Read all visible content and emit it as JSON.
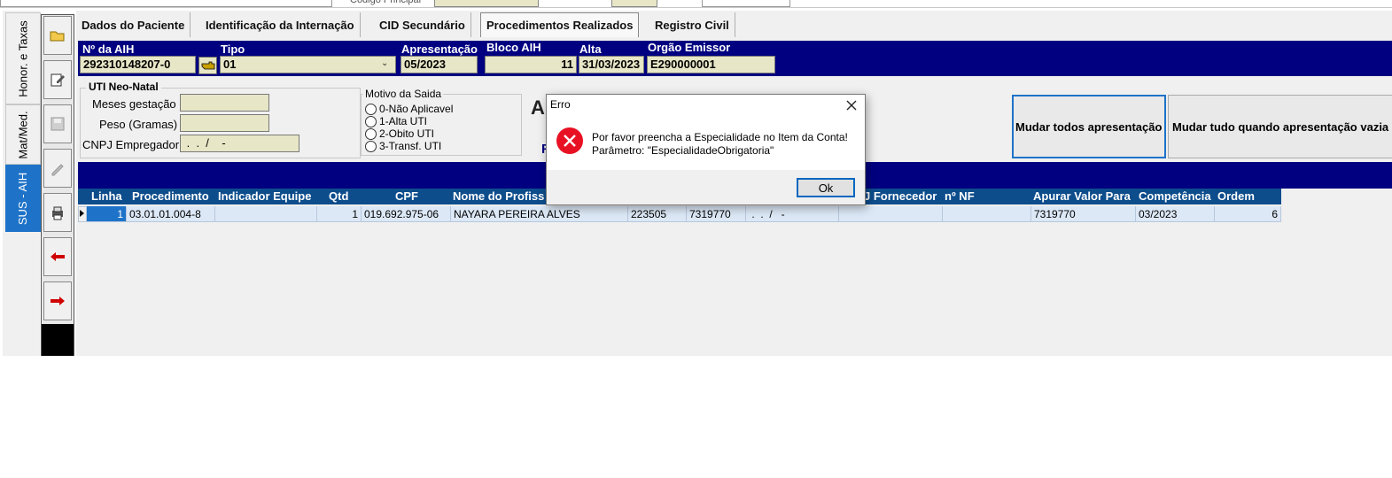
{
  "top_fragment": {
    "label": "Código Principal"
  },
  "side_tabs": [
    {
      "label": "Honor. e Taxas"
    },
    {
      "label": "Mat/Med."
    },
    {
      "label": "SUS - AIH"
    }
  ],
  "toolbar_icons": [
    "folder-open-icon",
    "edit-icon",
    "save-icon",
    "pen-icon",
    "printer-icon",
    "arrow-left-icon",
    "arrow-right-icon"
  ],
  "tabs": [
    {
      "label": "Dados do Paciente"
    },
    {
      "label": "Identificação da Internação"
    },
    {
      "label": "CID Secundário"
    },
    {
      "label": "Procedimentos Realizados"
    },
    {
      "label": "Registro Civil"
    }
  ],
  "header": {
    "aih_label": "Nº da AIH",
    "aih_value": "292310148207-0",
    "tipo_label": "Tipo",
    "tipo_value": "01",
    "apresentacao_label": "Apresentação",
    "apresentacao_value": "05/2023",
    "bloco_label": "Bloco AIH",
    "bloco_value": "11",
    "alta_label": "Alta",
    "alta_value": "31/03/2023",
    "orgao_label": "Orgão Emissor",
    "orgao_value": "E290000001"
  },
  "uti": {
    "title": "UTI Neo-Natal",
    "meses_label": "Meses gestação",
    "peso_label": "Peso (Gramas)",
    "cnpj_label": "CNPJ Empregador",
    "cnpj_value": " .  .  /    -"
  },
  "motivo": {
    "title": "Motivo da Saida",
    "options": [
      "0-Não Aplicavel",
      "1-Alta UTI",
      "2-Obito UTI",
      "3-Transf. UTI"
    ]
  },
  "hidden_fragments": {
    "a": "A",
    "p": "F"
  },
  "buttons": {
    "mudar_todos": "Mudar todos apresentação",
    "mudar_vazia": "Mudar tudo quando apresentação vazia"
  },
  "table": {
    "headers": {
      "linha": "Linha",
      "procedimento": "Procedimento",
      "indicador": "Indicador Equipe",
      "qtd": "Qtd",
      "cpf": "CPF",
      "nome": "Nome do Profiss",
      "fornecedor": "J Fornecedor",
      "nf": "nº NF",
      "apurar": "Apurar Valor Para",
      "competencia": "Competência",
      "ordem": "Ordem"
    },
    "row": {
      "linha": "1",
      "procedimento": "03.01.01.004-8",
      "indicador": "",
      "qtd": "1",
      "cpf": "019.692.975-06",
      "nome": "NAYARA PEREIRA ALVES",
      "cbo": "223505",
      "cnes": "7319770",
      "cnpj": " .  .  /   -",
      "fornecedor": "",
      "nf": "",
      "apurar": "7319770",
      "competencia": "03/2023",
      "ordem": "6"
    }
  },
  "dialog": {
    "title": "Erro",
    "message_line1": "Por favor preencha a Especialidade no Item da Conta!",
    "message_line2": "Parâmetro: \"EspecialidadeObrigatoria\"",
    "ok": "Ok"
  },
  "colors": {
    "navy": "#000080",
    "table_header": "#0d4d8c",
    "field": "#e7e6c6",
    "active_tab": "#1e73c8",
    "error_icon": "#e81123"
  }
}
